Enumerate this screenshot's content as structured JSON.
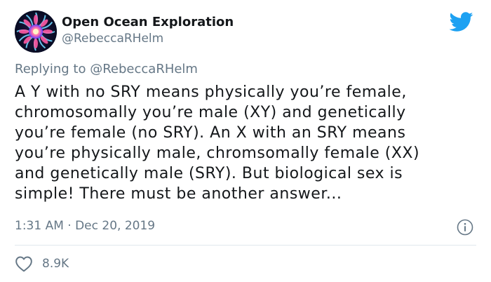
{
  "author": {
    "name": "Open Ocean Exploration",
    "handle": "@RebeccaRHelm",
    "avatar_icon": "jellyfish-avatar"
  },
  "reply": {
    "prefix": "Replying to",
    "mention": "@RebeccaRHelm"
  },
  "tweet": {
    "text": "A Y with no SRY means physically you’re female,\nchromosomally you’re male (XY) and genetically\nyou’re female (no SRY). An X with an SRY means\nyou’re physically male, chromsomally female (XX)\nand genetically male (SRY). But biological sex is\nsimple! There must be another answer...",
    "time": "1:31 AM · Dec 20, 2019"
  },
  "stats": {
    "likes": "8.9K"
  },
  "colors": {
    "twitter_blue": "#1da1f2",
    "muted": "#657786",
    "text": "#14171a",
    "divider": "#e1e8ed"
  },
  "icons": {
    "brand": "twitter-bird-icon",
    "info": "info-icon",
    "like": "heart-icon"
  }
}
